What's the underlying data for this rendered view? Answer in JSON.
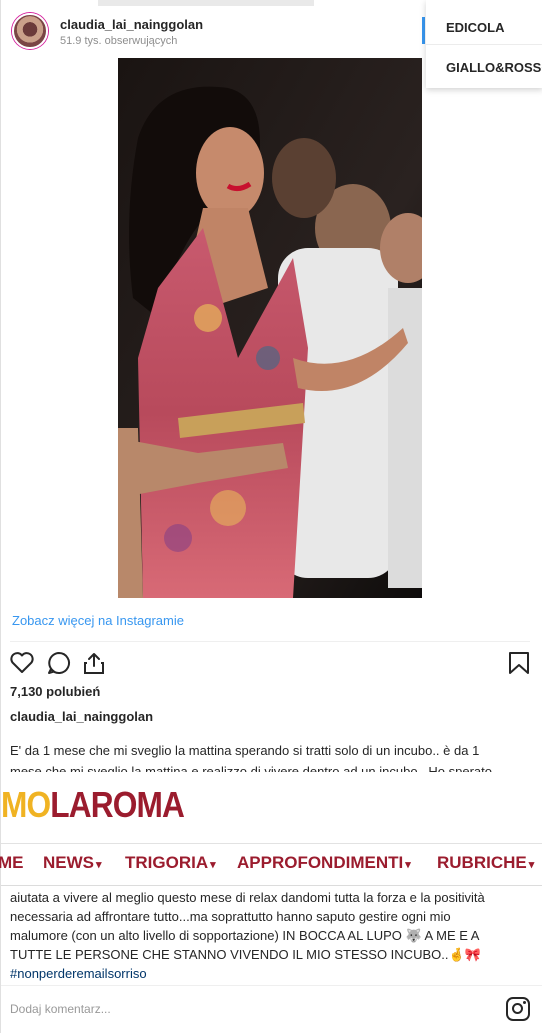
{
  "header": {
    "username": "claudia_lai_nainggolan",
    "followers": "51.9 tys. obserwujących"
  },
  "dropdown": {
    "items": [
      "EDICOLA",
      "GIALLO&ROSSO"
    ]
  },
  "photo": {
    "icon": "instagram-post-photo"
  },
  "post": {
    "see_more": "Zobacz więcej na Instagramie",
    "likes": "7,130 polubień",
    "owner": "claudia_lai_nainggolan",
    "caption_lines": [
      "E' da 1 mese che mi sveglio la mattina sperando si tratti solo di un incubo.. è da 1",
      "mese che mi sveglio la mattina e realizzo di vivere dentro ad un incubo.. Ho sperato"
    ],
    "caption_lines_lower": [
      "aiutata a vivere al meglio questo mese di relax dandomi tutta la forza e la positività",
      "necessaria ad affrontare tutto...ma soprattutto hanno saputo gestire ogni mio",
      "malumore (con un alto livello di sopportazione) IN BOCCA AL LUPO 🐺 A ME E A",
      "TUTTE LE PERSONE CHE STANNO VIVENDO IL MIO STESSO INCUBO..🤞🎀"
    ],
    "hashtag": "#nonperderemailsorriso",
    "comment_placeholder": "Dodaj komentarz...",
    "icons": {
      "like": "heart-icon",
      "comment": "comment-icon",
      "share": "share-icon",
      "save": "bookmark-icon",
      "brand": "instagram-icon"
    }
  },
  "site": {
    "logo_part1": "MO",
    "logo_part2": "LAROMA",
    "nav": [
      {
        "label": "ME"
      },
      {
        "label": "NEWS"
      },
      {
        "label": "TRIGORIA"
      },
      {
        "label": "APPROFONDIMENTI"
      },
      {
        "label": "RUBRICHE"
      }
    ],
    "colors": {
      "brand_red": "#9b1c2e",
      "brand_yellow": "#f0b323",
      "link_blue": "#3897f0"
    }
  }
}
